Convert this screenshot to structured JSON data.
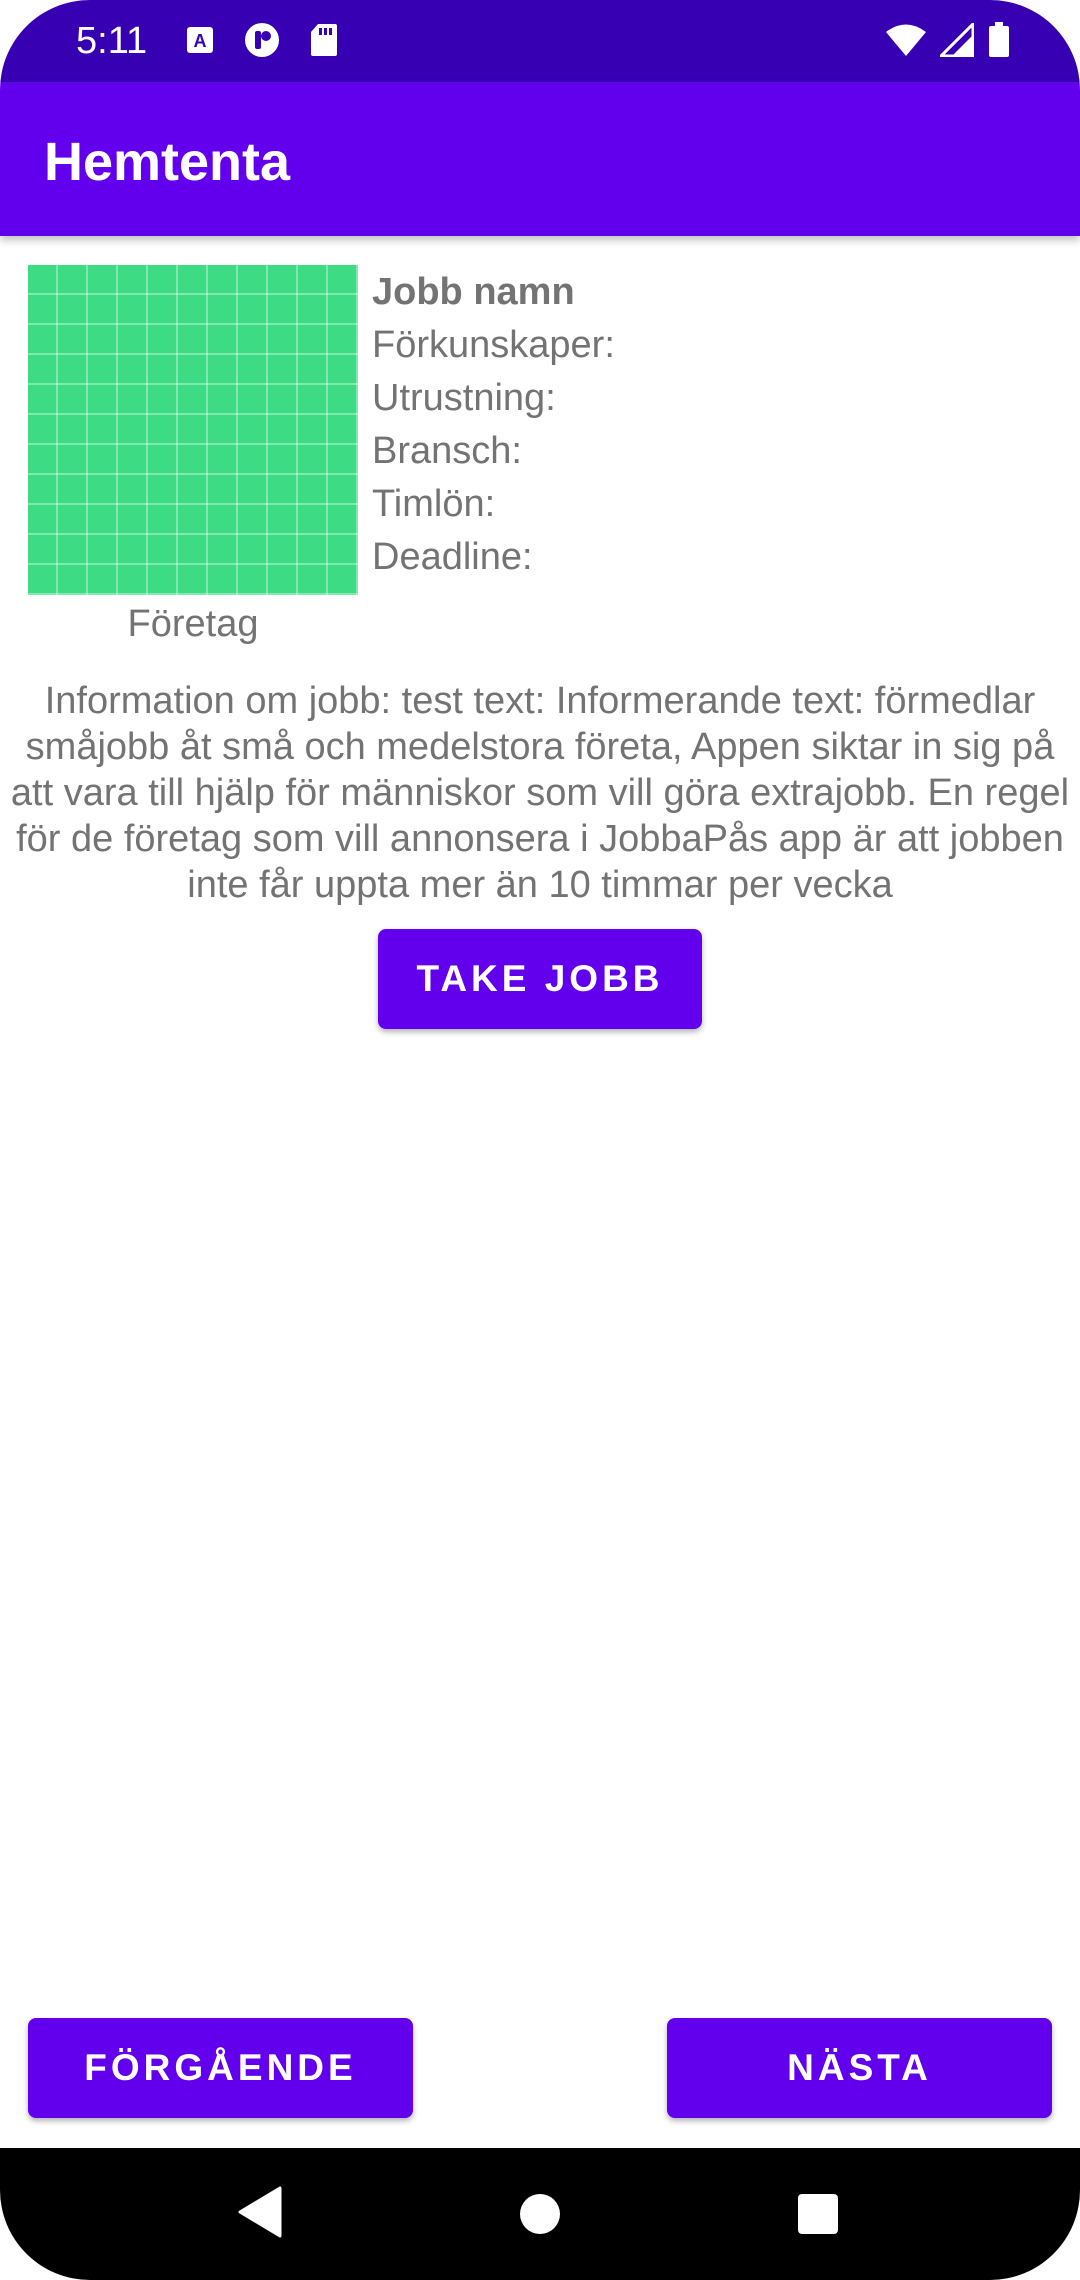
{
  "status_bar": {
    "time": "5:11",
    "left_icons": [
      "a-notification-icon",
      "circle-notification-icon",
      "sd-card-icon"
    ],
    "right_icons": [
      "wifi-icon",
      "signal-icon",
      "battery-icon"
    ]
  },
  "app_bar": {
    "title": "Hemtenta"
  },
  "job": {
    "company_label": "Företag",
    "name": "Jobb namn",
    "prerequisites_label": "Förkunskaper:",
    "equipment_label": "Utrustning:",
    "industry_label": "Bransch:",
    "hourly_wage_label": "Timlön:",
    "deadline_label": "Deadline:",
    "info": "Information om jobb: test text: Informerande text: förmedlar småjobb åt små och medelstora företa, Appen siktar in sig på att vara till hjälp för människor som vill göra extrajobb. En regel för de företag som vill annonsera i JobbaPås app är att jobben inte får uppta mer än 10 timmar per vecka"
  },
  "buttons": {
    "take_job": "Take Jobb",
    "previous": "Förgående",
    "next": "Nästa"
  },
  "colors": {
    "status_bar": "#3700B3",
    "app_bar": "#6200EE",
    "primary": "#6200EE",
    "image_placeholder": "#3DDC84",
    "secondary_text": "#737373"
  }
}
